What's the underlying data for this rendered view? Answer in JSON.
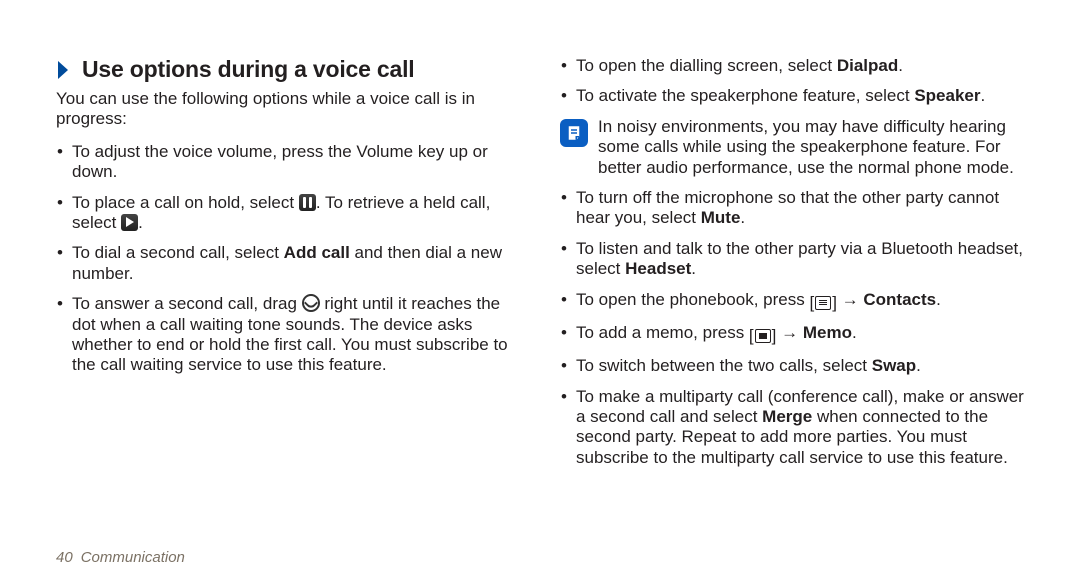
{
  "heading": "Use options during a voice call",
  "intro": "You can use the following options while a voice call is in progress:",
  "left_bullets": {
    "b1": "To adjust the voice volume, press the Volume key up or down.",
    "b2a": "To place a call on hold, select ",
    "b2b": ". To retrieve a held call, select ",
    "b2c": ".",
    "b3a": "To dial a second call, select ",
    "b3bold": "Add call",
    "b3b": " and then dial a new number.",
    "b4a": "To answer a second call, drag ",
    "b4b": " right until it reaches the dot when a call waiting tone sounds. The device asks whether to end or hold the first call. You must subscribe to the call waiting service to use this feature."
  },
  "right_bullets": {
    "r1a": "To open the dialling screen, select ",
    "r1bold": "Dialpad",
    "r1b": ".",
    "r2a": "To activate the speakerphone feature, select ",
    "r2bold": "Speaker",
    "r2b": ".",
    "note": "In noisy environments, you may have difficulty hearing some calls while using the speakerphone feature. For better audio performance, use the normal phone mode.",
    "r3a": "To turn off the microphone so that the other party cannot hear you, select ",
    "r3bold": "Mute",
    "r3b": ".",
    "r4a": "To listen and talk to the other party via a Bluetooth headset, select ",
    "r4bold": "Headset",
    "r4b": ".",
    "r5a": "To open the phonebook, press ",
    "r5arrow": " → ",
    "r5bold": "Contacts",
    "r5b": ".",
    "r6a": "To add a memo, press ",
    "r6arrow": " → ",
    "r6bold": "Memo",
    "r6b": ".",
    "r7a": "To switch between the two calls, select ",
    "r7bold": "Swap",
    "r7b": ".",
    "r8a": "To make a multiparty call (conference call), make or answer a second call and select ",
    "r8bold": "Merge",
    "r8b": " when connected to the second party. Repeat to add more parties. You must subscribe to the multiparty call service to use this feature."
  },
  "footer": {
    "page": "40",
    "section": "Communication"
  },
  "icons": {
    "hold": "pause-icon",
    "retrieve": "play-icon",
    "answer": "phone-icon",
    "menu": "menu-icon",
    "note": "memo-note-icon"
  }
}
